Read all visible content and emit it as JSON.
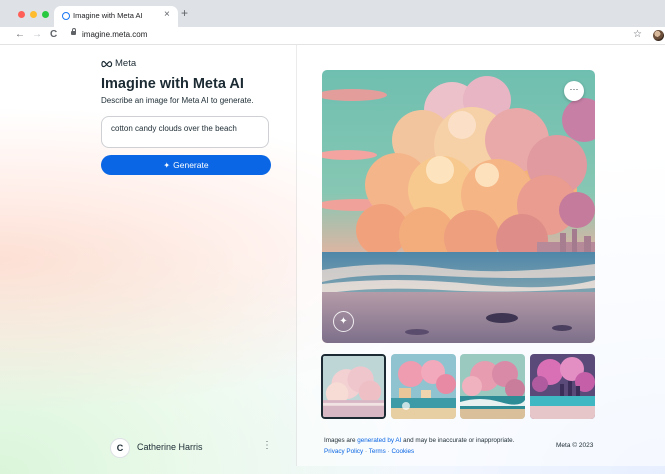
{
  "browser": {
    "tab_title": "Imagine with Meta AI",
    "new_tab_label": "+",
    "close_tab_label": "×",
    "back_label": "←",
    "forward_label": "→",
    "reload_label": "C",
    "url": "imagine.meta.com",
    "bookmark_label": "☆",
    "traffic_lights": [
      "#ff5f57",
      "#febc2e",
      "#28c840"
    ]
  },
  "brand": {
    "logo_text": "Meta",
    "accent": "#0a66e4"
  },
  "header": {
    "title": "Imagine with Meta AI",
    "subtitle": "Describe an image for Meta AI to generate."
  },
  "prompt": {
    "value": "cotton candy clouds over the beach"
  },
  "generate_button": {
    "label": "Generate",
    "icon": "sparkle-icon"
  },
  "user": {
    "initial": "C",
    "name": "Catherine Harris",
    "menu_icon": "⋮"
  },
  "image_viewer": {
    "menu_label": "···",
    "watermark_icon": "imagined-with-ai-watermark-icon",
    "thumbnail_count": 4,
    "selected_thumbnail": 0
  },
  "footer": {
    "note_prefix": "Images are ",
    "note_link": "generated by AI",
    "note_suffix": " and may be inaccurate or inappropriate.",
    "privacy": "Privacy Policy",
    "sep1": " · ",
    "terms": "Terms",
    "sep2": " · ",
    "cookies": "Cookies",
    "copyright": "Meta © 2023"
  }
}
